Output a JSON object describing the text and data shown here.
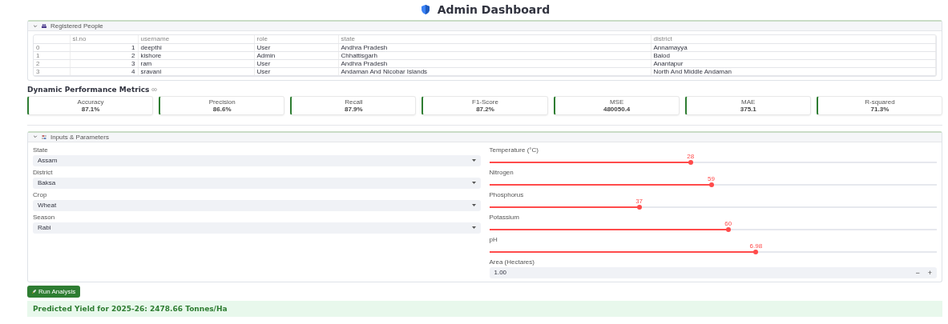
{
  "title": "Admin Dashboard",
  "people": {
    "label": "Registered People",
    "expanded": true,
    "columns": [
      "",
      "sl.no",
      "username",
      "role",
      "state",
      "district"
    ],
    "rows": [
      [
        "0",
        "1",
        "deepthi",
        "User",
        "Andhra Pradesh",
        "Annamayya"
      ],
      [
        "1",
        "2",
        "kishore",
        "Admin",
        "Chhattisgarh",
        "Balod"
      ],
      [
        "2",
        "3",
        "ram",
        "User",
        "Andhra Pradesh",
        "Anantapur"
      ],
      [
        "3",
        "4",
        "sravani",
        "User",
        "Andaman And Nicobar Islands",
        "North And Middle Andaman"
      ]
    ]
  },
  "metrics": {
    "heading": "Dynamic Performance Metrics",
    "items": [
      {
        "label": "Accuracy",
        "value": "87.1%"
      },
      {
        "label": "Precision",
        "value": "86.6%"
      },
      {
        "label": "Recall",
        "value": "87.9%"
      },
      {
        "label": "F1-Score",
        "value": "87.2%"
      },
      {
        "label": "MSE",
        "value": "480050.4"
      },
      {
        "label": "MAE",
        "value": "375.1"
      },
      {
        "label": "R-squared",
        "value": "71.3%"
      }
    ]
  },
  "inputs": {
    "label": "Inputs & Parameters",
    "expanded": true,
    "selects": [
      {
        "label": "State",
        "value": "Assam"
      },
      {
        "label": "District",
        "value": "Baksa"
      },
      {
        "label": "Crop",
        "value": "Wheat"
      },
      {
        "label": "Season",
        "value": "Rabi"
      }
    ],
    "sliders": [
      {
        "label": "Temperature (°C)",
        "reading": "28",
        "level": 0.45
      },
      {
        "label": "Nitrogen",
        "reading": "59",
        "level": 0.496
      },
      {
        "label": "Phosphorus",
        "reading": "37",
        "level": 0.335
      },
      {
        "label": "Potassium",
        "reading": "60",
        "level": 0.534
      },
      {
        "label": "pH",
        "reading": "6.98",
        "level": 0.596
      }
    ],
    "number": {
      "label": "Area (Hectares)",
      "value": "1.00",
      "minus": "−",
      "plus": "+"
    }
  },
  "button": "Run Analysis",
  "result": "Predicted Yield for 2025-26: 2478.66 Tonnes/Ha"
}
